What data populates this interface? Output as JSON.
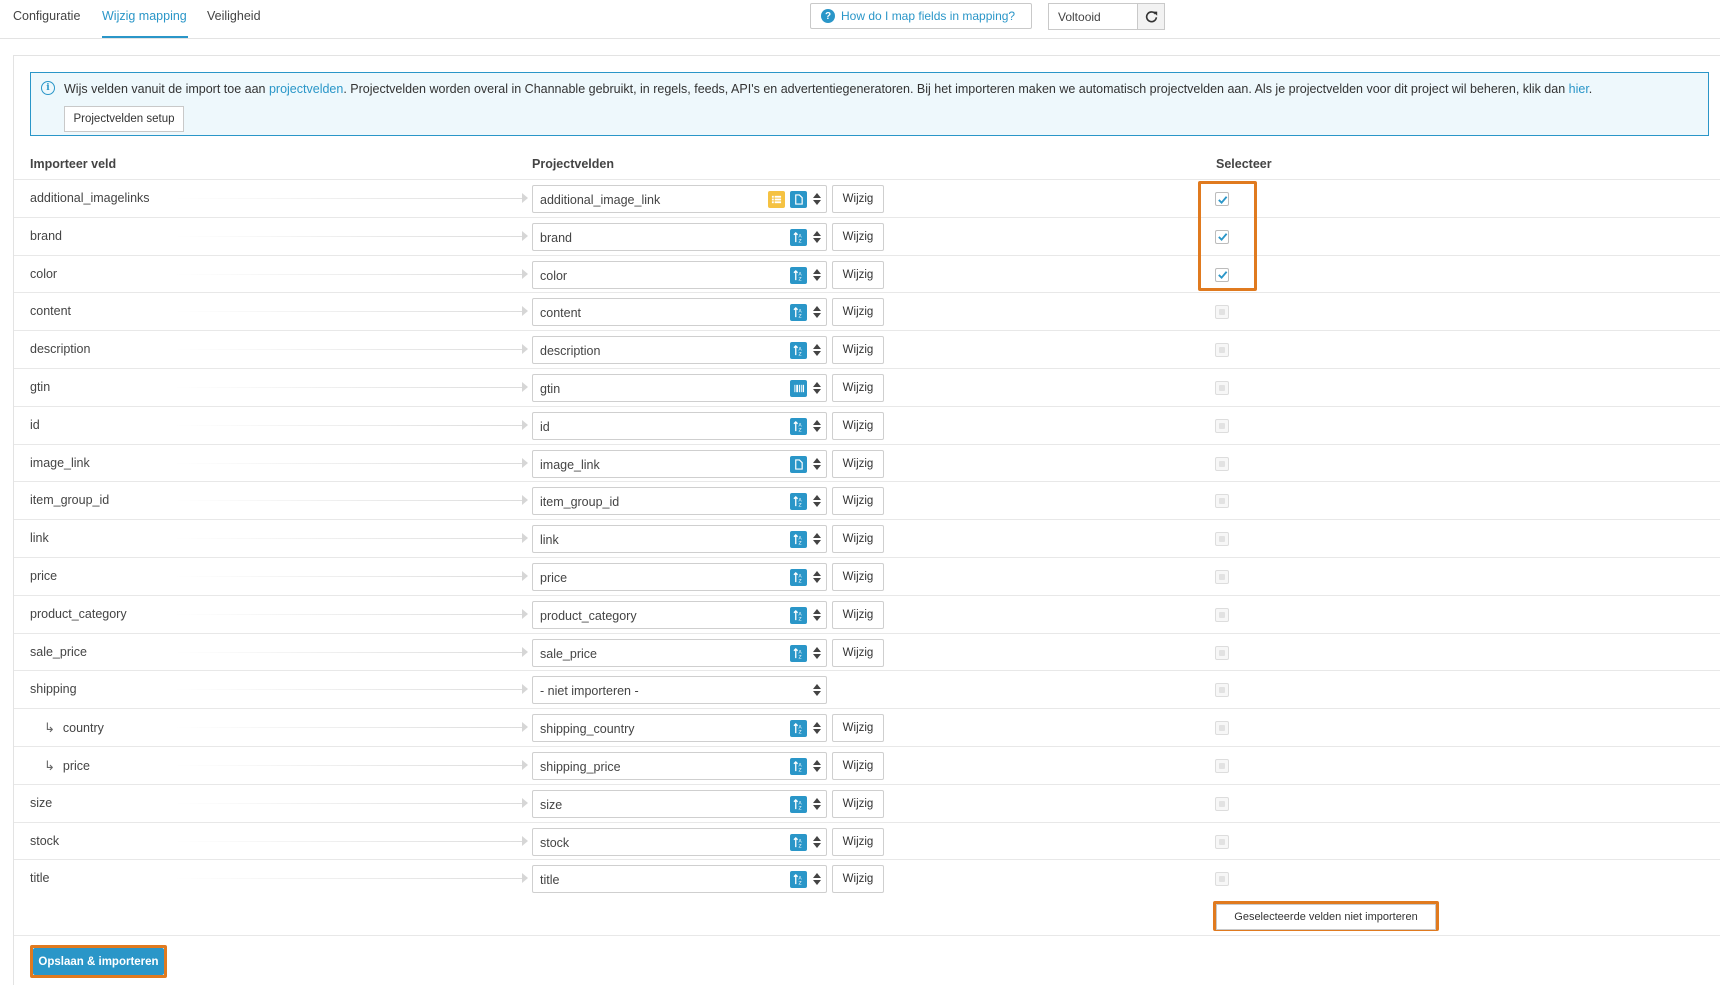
{
  "tabs": [
    {
      "label": "Configuratie",
      "active": false
    },
    {
      "label": "Wijzig mapping",
      "active": true
    },
    {
      "label": "Veiligheid",
      "active": false
    }
  ],
  "help_button": {
    "label": "How do I map fields in mapping?",
    "icon": "question-circle-icon"
  },
  "status": {
    "value": "Voltooid",
    "refresh_icon": "refresh-icon"
  },
  "info": {
    "text_before": "Wijs velden vanuit de import toe aan ",
    "link1": "projectvelden",
    "text_middle": ". Projectvelden worden overal in Channable gebruikt, in regels, feeds, API's en advertentiegeneratoren. Bij het importeren maken we automatisch projectvelden aan. Als je projectvelden voor dit project wil beheren, klik dan ",
    "link2": "hier",
    "text_after": ".",
    "setup_button": "Projectvelden setup"
  },
  "columns": {
    "import_field": "Importeer veld",
    "project_fields": "Projectvelden",
    "select": "Selecteer"
  },
  "rows": [
    {
      "import": "additional_imagelinks",
      "project": "additional_image_link",
      "icons": [
        "list-icon",
        "file-icon"
      ],
      "wijzig": "Wijzig",
      "checked": true,
      "sub": false
    },
    {
      "import": "brand",
      "project": "brand",
      "icons": [
        "sort-alpha-icon"
      ],
      "wijzig": "Wijzig",
      "checked": true,
      "sub": false
    },
    {
      "import": "color",
      "project": "color",
      "icons": [
        "sort-alpha-icon"
      ],
      "wijzig": "Wijzig",
      "checked": true,
      "sub": false
    },
    {
      "import": "content",
      "project": "content",
      "icons": [
        "sort-alpha-icon"
      ],
      "wijzig": "Wijzig",
      "checked": false,
      "sub": false
    },
    {
      "import": "description",
      "project": "description",
      "icons": [
        "sort-alpha-icon"
      ],
      "wijzig": "Wijzig",
      "checked": false,
      "sub": false
    },
    {
      "import": "gtin",
      "project": "gtin",
      "icons": [
        "barcode-icon"
      ],
      "wijzig": "Wijzig",
      "checked": false,
      "sub": false
    },
    {
      "import": "id",
      "project": "id",
      "icons": [
        "sort-alpha-icon"
      ],
      "wijzig": "Wijzig",
      "checked": false,
      "sub": false
    },
    {
      "import": "image_link",
      "project": "image_link",
      "icons": [
        "file-icon"
      ],
      "wijzig": "Wijzig",
      "checked": false,
      "sub": false
    },
    {
      "import": "item_group_id",
      "project": "item_group_id",
      "icons": [
        "sort-alpha-icon"
      ],
      "wijzig": "Wijzig",
      "checked": false,
      "sub": false
    },
    {
      "import": "link",
      "project": "link",
      "icons": [
        "sort-alpha-icon"
      ],
      "wijzig": "Wijzig",
      "checked": false,
      "sub": false
    },
    {
      "import": "price",
      "project": "price",
      "icons": [
        "sort-alpha-icon"
      ],
      "wijzig": "Wijzig",
      "checked": false,
      "sub": false
    },
    {
      "import": "product_category",
      "project": "product_category",
      "icons": [
        "sort-alpha-icon"
      ],
      "wijzig": "Wijzig",
      "checked": false,
      "sub": false
    },
    {
      "import": "sale_price",
      "project": "sale_price",
      "icons": [
        "sort-alpha-icon"
      ],
      "wijzig": "Wijzig",
      "checked": false,
      "sub": false
    },
    {
      "import": "shipping",
      "project": "- niet importeren -",
      "icons": [],
      "wijzig": "",
      "checked": false,
      "sub": false
    },
    {
      "import": "country",
      "project": "shipping_country",
      "icons": [
        "sort-alpha-icon"
      ],
      "wijzig": "Wijzig",
      "checked": false,
      "sub": true
    },
    {
      "import": "price",
      "project": "shipping_price",
      "icons": [
        "sort-alpha-icon"
      ],
      "wijzig": "Wijzig",
      "checked": false,
      "sub": true
    },
    {
      "import": "size",
      "project": "size",
      "icons": [
        "sort-alpha-icon"
      ],
      "wijzig": "Wijzig",
      "checked": false,
      "sub": false
    },
    {
      "import": "stock",
      "project": "stock",
      "icons": [
        "sort-alpha-icon"
      ],
      "wijzig": "Wijzig",
      "checked": false,
      "sub": false
    },
    {
      "import": "title",
      "project": "title",
      "icons": [
        "sort-alpha-icon"
      ],
      "wijzig": "Wijzig",
      "checked": false,
      "sub": false
    }
  ],
  "deselect_button": "Geselecteerde velden niet importeren",
  "save_button": "Opslaan & importeren",
  "colors": {
    "accent": "#2a96c8",
    "highlight": "#e07a1f",
    "warning_icon": "#f5c242"
  }
}
